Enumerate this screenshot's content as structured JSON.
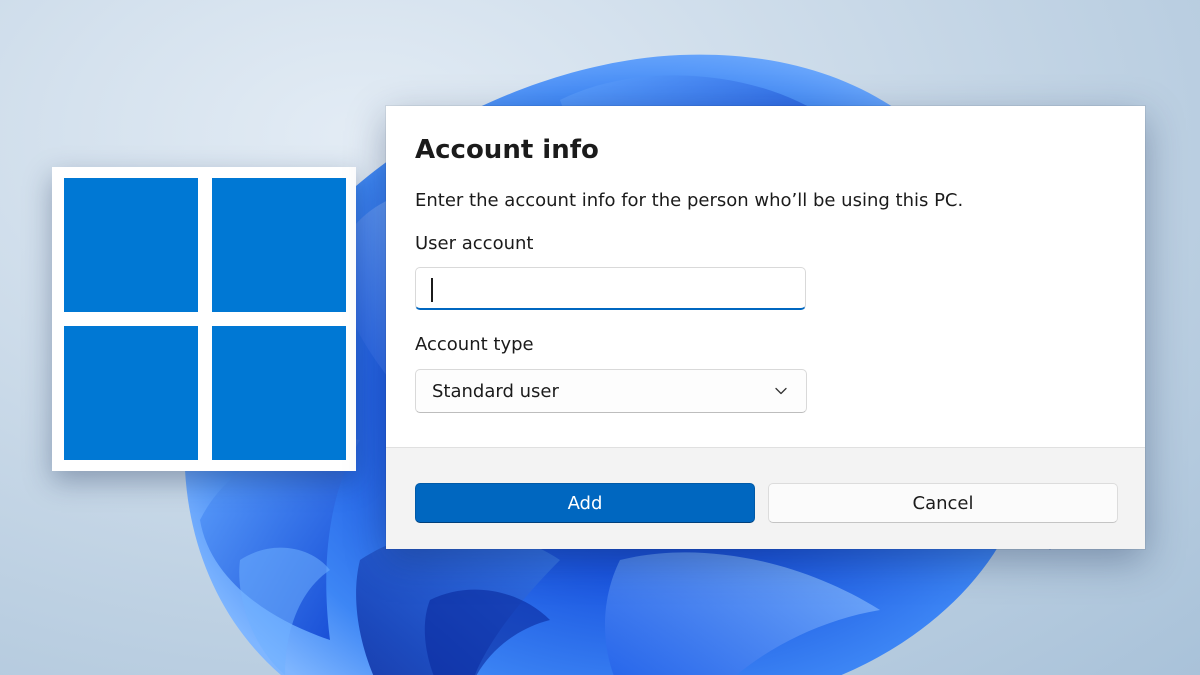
{
  "colors": {
    "accent": "#0067c0",
    "logo_blue": "#0078d4",
    "dialog_bg": "#ffffff",
    "footer_bg": "#f3f3f3",
    "text": "#1b1b1b"
  },
  "logo": {
    "icon": "windows-logo-icon"
  },
  "dialog": {
    "title": "Account info",
    "description": "Enter the account info for the person who’ll be using this PC.",
    "user_account": {
      "label": "User account",
      "value": "",
      "placeholder": ""
    },
    "account_type": {
      "label": "Account type",
      "selected": "Standard user",
      "icon": "chevron-down-icon"
    },
    "buttons": {
      "add_label": "Add",
      "cancel_label": "Cancel"
    }
  }
}
